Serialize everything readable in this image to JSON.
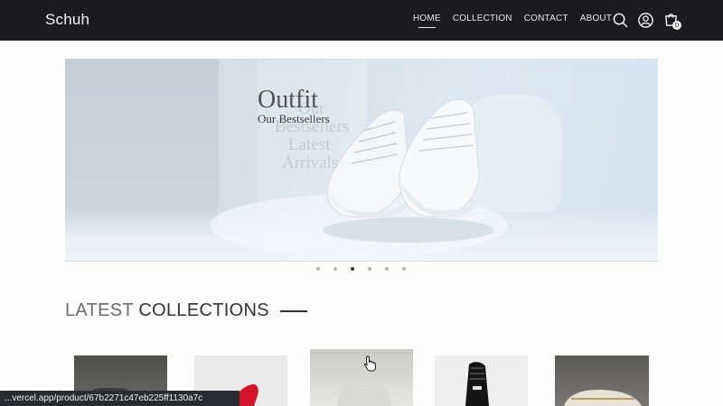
{
  "brand": {
    "logo": "Schuh"
  },
  "nav": {
    "links": [
      {
        "label": "HOME",
        "active": true
      },
      {
        "label": "COLLECTION",
        "active": false
      },
      {
        "label": "CONTACT",
        "active": false
      },
      {
        "label": "ABOUT",
        "active": false
      }
    ],
    "icons": [
      "search-icon",
      "user-icon",
      "cart-icon"
    ],
    "cart_count": "0"
  },
  "hero": {
    "title": "Outfit",
    "subtitle": "Our Bestsellers",
    "ghost_lines": [
      "Our",
      "Bestsellers",
      "Latest",
      "Arrivals"
    ],
    "slide_count": 6,
    "active_slide": 3
  },
  "collections": {
    "title_light": "LATEST",
    "title_strong": "COLLECTIONS"
  },
  "status_bar": {
    "url": "...vercel.app/product/67b2271c47eb225ff1130a7c"
  },
  "colors": {
    "navbar": "#1b1b1d",
    "accent": "#333333",
    "background": "#fdfdfe"
  }
}
